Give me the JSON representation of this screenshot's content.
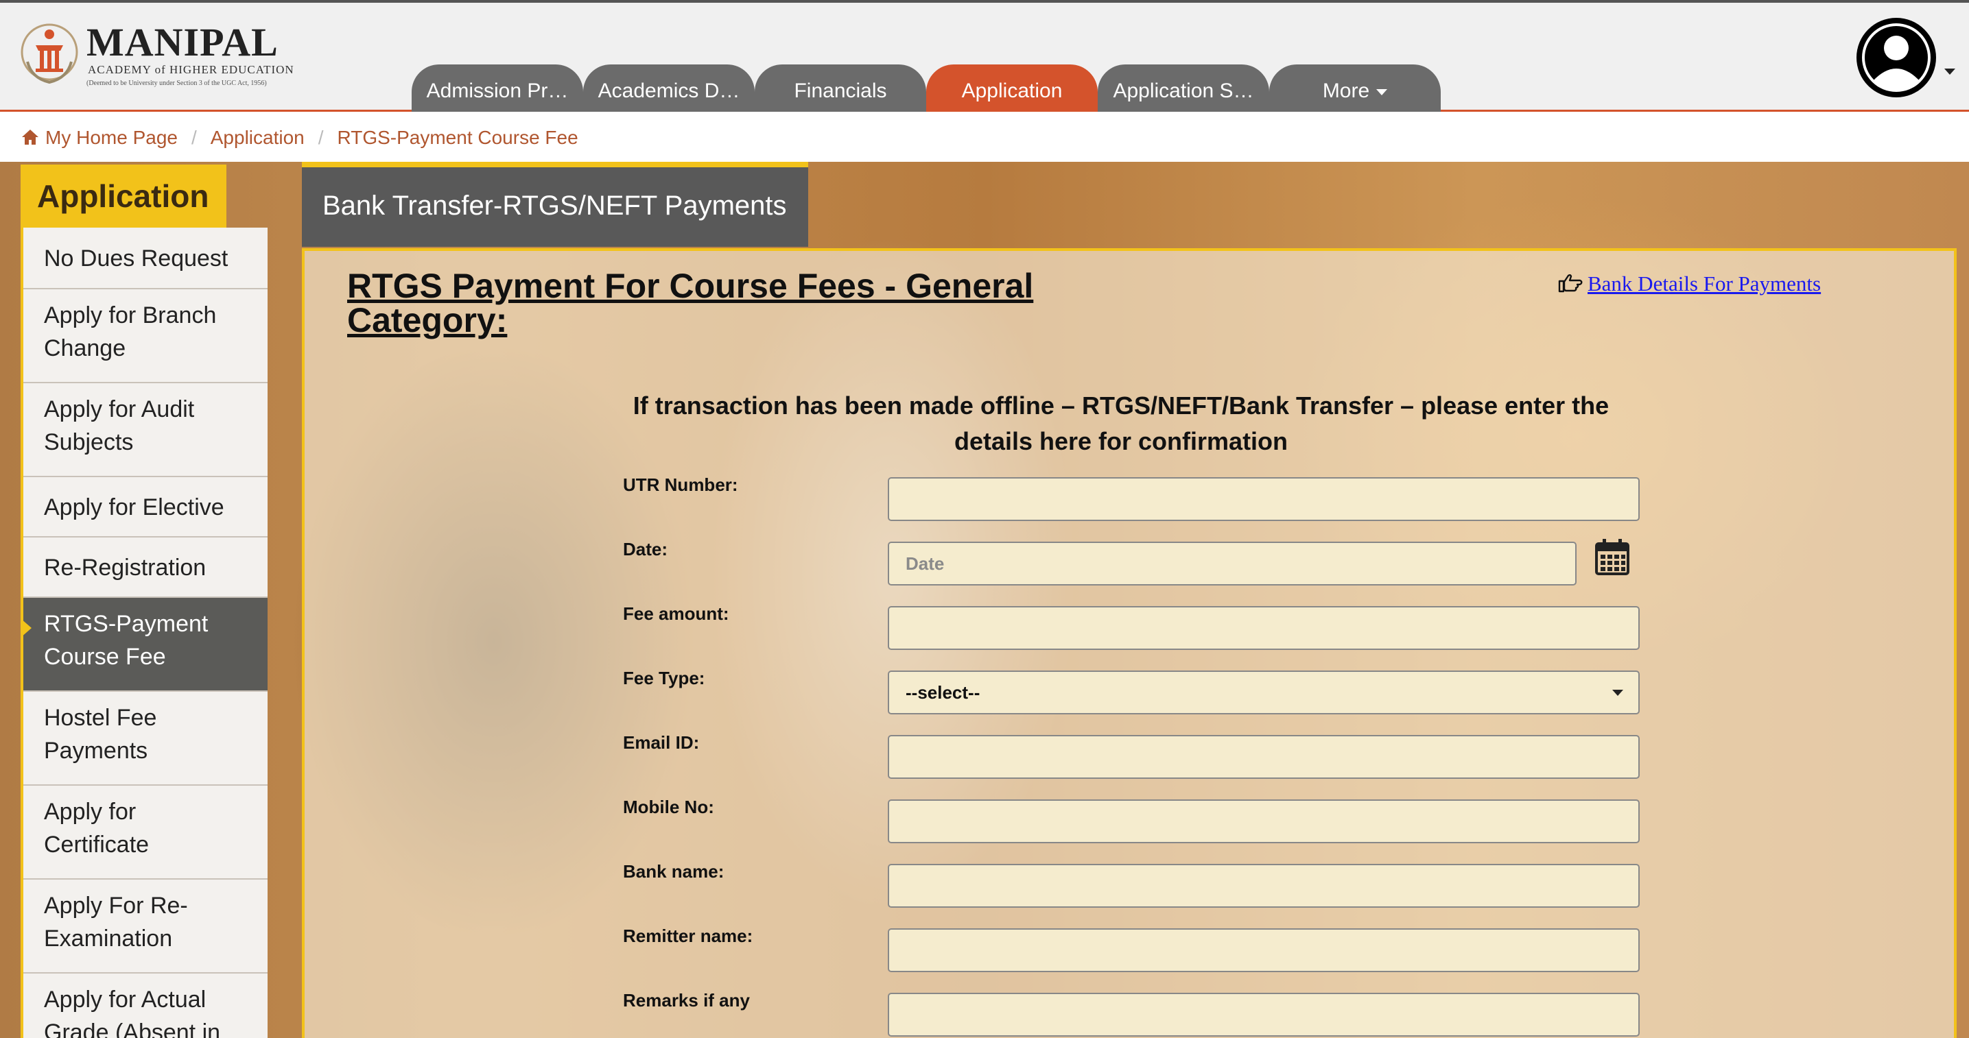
{
  "header": {
    "logo": {
      "brand": "MANIPAL",
      "subtitle": "ACADEMY of HIGHER EDUCATION",
      "tagline": "(Deemed to be University under Section 3 of the UGC Act, 1956)"
    },
    "tabs": [
      {
        "label": "Admission Pr…"
      },
      {
        "label": "Academics D…"
      },
      {
        "label": "Financials"
      },
      {
        "label": "Application"
      },
      {
        "label": "Application S…"
      },
      {
        "label": "More"
      }
    ],
    "colors": {
      "active_tab": "#d4532c",
      "tab": "#6b6b6b"
    }
  },
  "breadcrumb": {
    "items": [
      "My Home Page",
      "Application",
      "RTGS-Payment Course Fee"
    ]
  },
  "sidebar": {
    "title": "Application",
    "items": [
      {
        "label": "No Dues Request"
      },
      {
        "label": "Apply for Branch Change"
      },
      {
        "label": "Apply for Audit Subjects"
      },
      {
        "label": "Apply for Elective"
      },
      {
        "label": "Re-Registration"
      },
      {
        "label": "RTGS-Payment Course Fee"
      },
      {
        "label": "Hostel Fee Payments"
      },
      {
        "label": "Apply for Certificate"
      },
      {
        "label": "Apply For Re-Examination"
      },
      {
        "label": "Apply for Actual Grade (Absent in"
      }
    ],
    "active_index": 5,
    "accent": "#f2c21a"
  },
  "panel": {
    "title": "Bank Transfer-RTGS/NEFT Payments",
    "form_title": "RTGS Payment For Course Fees - General Category:",
    "bank_link": "Bank Details For Payments",
    "instruction": "If transaction has been made offline – RTGS/NEFT/Bank Transfer – please enter the details here for confirmation",
    "fields": {
      "utr": {
        "label": "UTR Number:",
        "value": ""
      },
      "date": {
        "label": "Date:",
        "value": "",
        "placeholder": "Date"
      },
      "fee_amount": {
        "label": "Fee amount:",
        "value": ""
      },
      "fee_type": {
        "label": "Fee Type:",
        "selected": "--select--"
      },
      "email": {
        "label": "Email ID:",
        "value": ""
      },
      "mobile": {
        "label": "Mobile No:",
        "value": ""
      },
      "bank_name": {
        "label": "Bank name:",
        "value": ""
      },
      "remitter": {
        "label": "Remitter name:",
        "value": ""
      },
      "remarks": {
        "label": "Remarks if any",
        "value": ""
      }
    }
  }
}
